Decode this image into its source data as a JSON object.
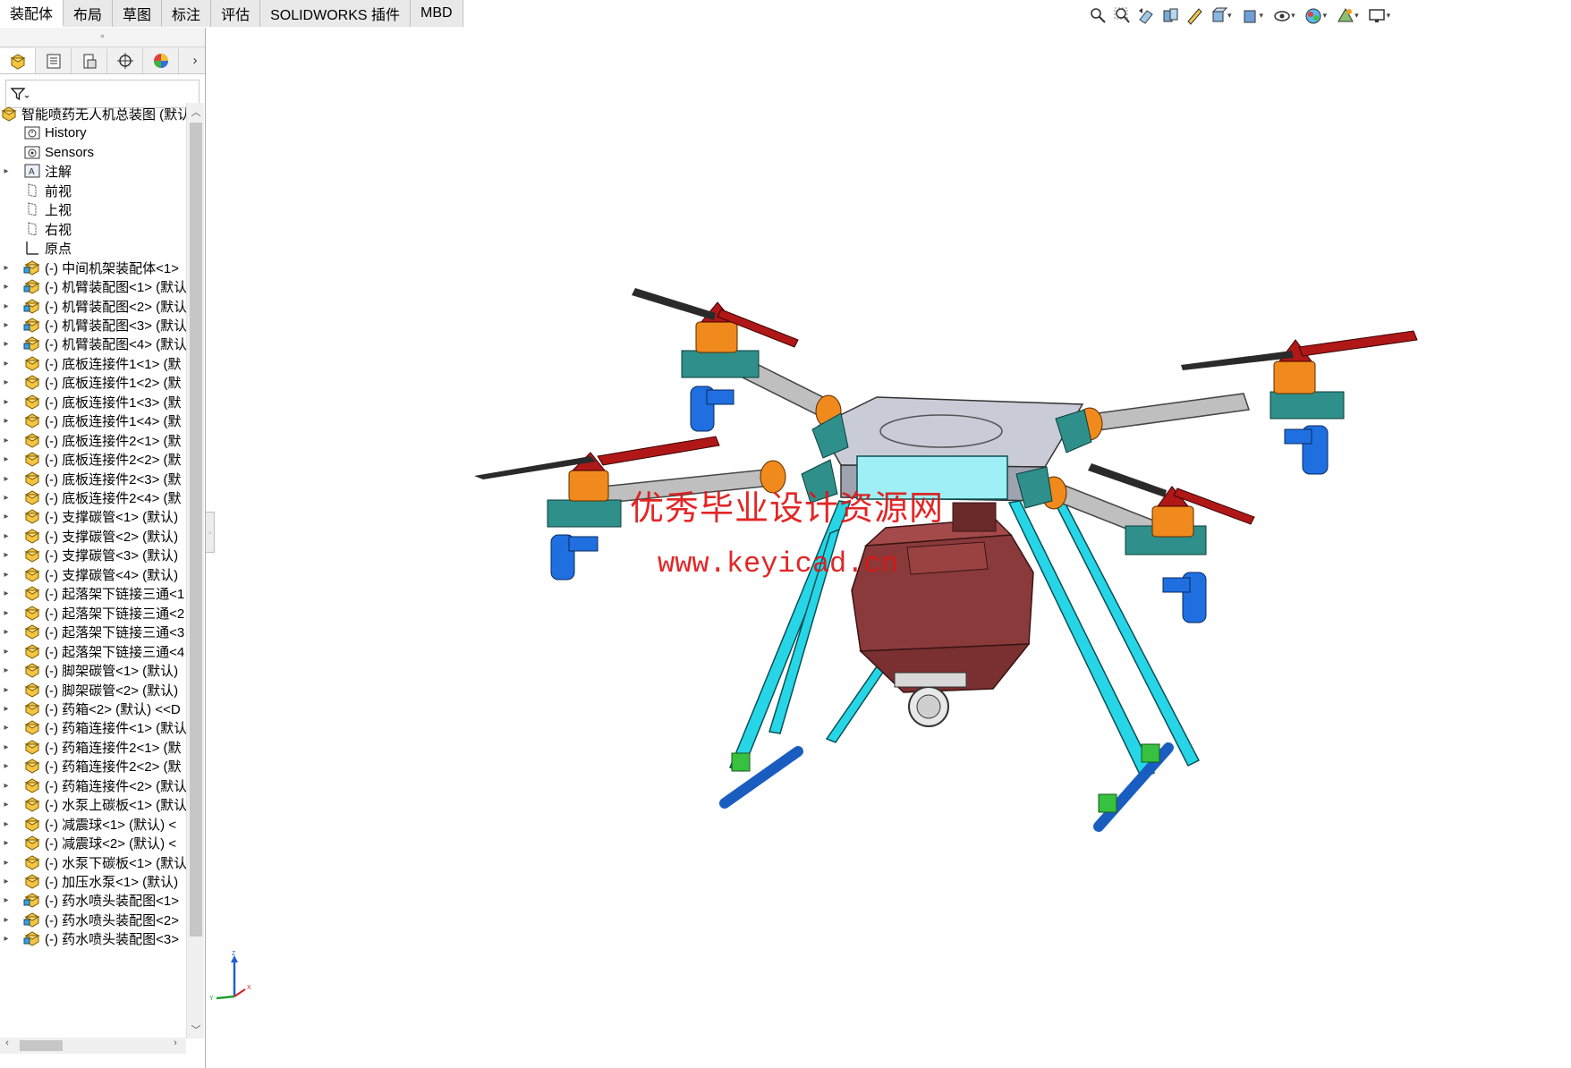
{
  "tabs": [
    {
      "label": "装配体",
      "active": true
    },
    {
      "label": "布局"
    },
    {
      "label": "草图"
    },
    {
      "label": "标注"
    },
    {
      "label": "评估"
    },
    {
      "label": "SOLIDWORKS 插件"
    },
    {
      "label": "MBD"
    }
  ],
  "hud_icons": [
    "zoom-to-fit-icon",
    "zoom-to-area-icon",
    "previous-view-icon",
    "section-view-icon",
    "dynamic-annotation-icon",
    "view-orientation-icon",
    "display-style-icon",
    "hide-show-items-icon",
    "edit-appearance-icon",
    "apply-scene-icon",
    "view-settings-icon"
  ],
  "pane_tabs": [
    "feature-manager-icon",
    "property-manager-icon",
    "configuration-manager-icon",
    "dimxpert-icon",
    "display-manager-icon"
  ],
  "tree": {
    "root": "智能喷药无人机总装图 (默认",
    "items": [
      {
        "label": "History",
        "icon": "history-folder-icon",
        "expand": false
      },
      {
        "label": "Sensors",
        "icon": "sensors-folder-icon",
        "expand": false
      },
      {
        "label": "注解",
        "icon": "annotations-folder-icon",
        "expand": true
      },
      {
        "label": "前视",
        "icon": "plane-icon",
        "expand": false
      },
      {
        "label": "上视",
        "icon": "plane-icon",
        "expand": false
      },
      {
        "label": "右视",
        "icon": "plane-icon",
        "expand": false
      },
      {
        "label": "原点",
        "icon": "origin-icon",
        "expand": false
      },
      {
        "label": "(-) 中间机架装配体<1>",
        "icon": "subassembly-icon",
        "expand": true
      },
      {
        "label": "(-) 机臂装配图<1> (默认",
        "icon": "subassembly-icon",
        "expand": true
      },
      {
        "label": "(-) 机臂装配图<2> (默认",
        "icon": "subassembly-icon",
        "expand": true
      },
      {
        "label": "(-) 机臂装配图<3> (默认",
        "icon": "subassembly-icon",
        "expand": true
      },
      {
        "label": "(-) 机臂装配图<4> (默认",
        "icon": "subassembly-icon",
        "expand": true
      },
      {
        "label": "(-) 底板连接件1<1> (默",
        "icon": "part-icon",
        "expand": true
      },
      {
        "label": "(-) 底板连接件1<2> (默",
        "icon": "part-icon",
        "expand": true
      },
      {
        "label": "(-) 底板连接件1<3> (默",
        "icon": "part-icon",
        "expand": true
      },
      {
        "label": "(-) 底板连接件1<4> (默",
        "icon": "part-icon",
        "expand": true
      },
      {
        "label": "(-) 底板连接件2<1> (默",
        "icon": "part-icon",
        "expand": true
      },
      {
        "label": "(-) 底板连接件2<2> (默",
        "icon": "part-icon",
        "expand": true
      },
      {
        "label": "(-) 底板连接件2<3> (默",
        "icon": "part-icon",
        "expand": true
      },
      {
        "label": "(-) 底板连接件2<4> (默",
        "icon": "part-icon",
        "expand": true
      },
      {
        "label": "(-) 支撑碳管<1> (默认)",
        "icon": "part-icon",
        "expand": true
      },
      {
        "label": "(-) 支撑碳管<2> (默认)",
        "icon": "part-icon",
        "expand": true
      },
      {
        "label": "(-) 支撑碳管<3> (默认)",
        "icon": "part-icon",
        "expand": true
      },
      {
        "label": "(-) 支撑碳管<4> (默认)",
        "icon": "part-icon",
        "expand": true
      },
      {
        "label": "(-) 起落架下链接三通<1",
        "icon": "part-icon",
        "expand": true
      },
      {
        "label": "(-) 起落架下链接三通<2",
        "icon": "part-icon",
        "expand": true
      },
      {
        "label": "(-) 起落架下链接三通<3",
        "icon": "part-icon",
        "expand": true
      },
      {
        "label": "(-) 起落架下链接三通<4",
        "icon": "part-icon",
        "expand": true
      },
      {
        "label": "(-) 脚架碳管<1> (默认)",
        "icon": "part-icon",
        "expand": true
      },
      {
        "label": "(-) 脚架碳管<2> (默认)",
        "icon": "part-icon",
        "expand": true
      },
      {
        "label": "(-) 药箱<2> (默认) <<D",
        "icon": "part-icon",
        "expand": true
      },
      {
        "label": "(-) 药箱连接件<1> (默认",
        "icon": "part-icon",
        "expand": true
      },
      {
        "label": "(-) 药箱连接件2<1> (默",
        "icon": "part-icon",
        "expand": true
      },
      {
        "label": "(-) 药箱连接件2<2> (默",
        "icon": "part-icon",
        "expand": true
      },
      {
        "label": "(-) 药箱连接件<2> (默认",
        "icon": "part-icon",
        "expand": true
      },
      {
        "label": "(-) 水泵上碳板<1> (默认",
        "icon": "part-icon",
        "expand": true
      },
      {
        "label": "(-) 减震球<1> (默认) <",
        "icon": "part-icon",
        "expand": true
      },
      {
        "label": "(-) 减震球<2> (默认) <",
        "icon": "part-icon",
        "expand": true
      },
      {
        "label": "(-) 水泵下碳板<1> (默认",
        "icon": "part-icon",
        "expand": true
      },
      {
        "label": "(-) 加压水泵<1> (默认)",
        "icon": "part-icon",
        "expand": true
      },
      {
        "label": "(-) 药水喷头装配图<1>",
        "icon": "subassembly-icon",
        "expand": true
      },
      {
        "label": "(-) 药水喷头装配图<2>",
        "icon": "subassembly-icon",
        "expand": true
      },
      {
        "label": "(-) 药水喷头装配图<3>",
        "icon": "subassembly-icon",
        "expand": true
      }
    ]
  },
  "watermark": {
    "line1": "优秀毕业设计资源网",
    "line2": "www.keyicad.cn"
  },
  "triad": {
    "x": "X",
    "y": "Y",
    "z": "Z"
  },
  "colors": {
    "frame": "#c9ccd6",
    "arm_tube": "#bfbfbf",
    "arm_end": "#2f8f8a",
    "motor_orange": "#f08a1c",
    "prop_red": "#b01818",
    "nozzle_blue": "#1f6fe0",
    "leg_cyan": "#27d6e6",
    "tank_brown": "#8a3a3a",
    "connector_green": "#38c040"
  }
}
